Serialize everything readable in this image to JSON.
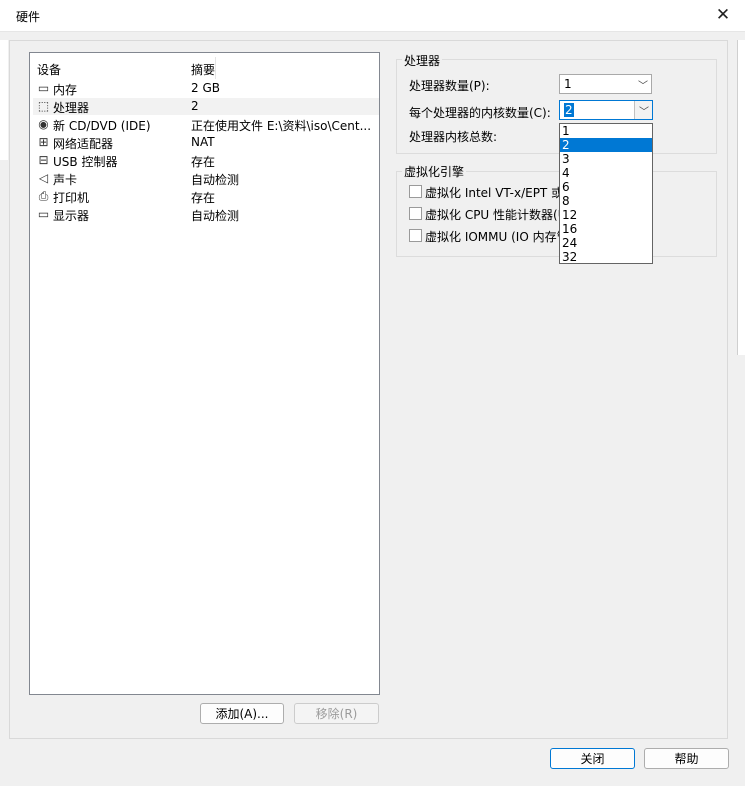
{
  "window": {
    "title": "硬件",
    "close_glyph": "✕"
  },
  "devices": {
    "col_device": "设备",
    "col_summary": "摘要",
    "items": [
      {
        "icon": "memory-icon",
        "glyph": "▭",
        "name": "内存",
        "summary": "2 GB",
        "selected": false
      },
      {
        "icon": "cpu-icon",
        "glyph": "⬚",
        "name": "处理器",
        "summary": "2",
        "selected": true
      },
      {
        "icon": "cd-icon",
        "glyph": "◉",
        "name": "新 CD/DVD (IDE)",
        "summary": "正在使用文件 E:\\资料\\iso\\Cent...",
        "selected": false
      },
      {
        "icon": "network-icon",
        "glyph": "⊞",
        "name": "网络适配器",
        "summary": "NAT",
        "selected": false
      },
      {
        "icon": "usb-icon",
        "glyph": "⊟",
        "name": "USB 控制器",
        "summary": "存在",
        "selected": false
      },
      {
        "icon": "sound-icon",
        "glyph": "◁",
        "name": "声卡",
        "summary": "自动检测",
        "selected": false
      },
      {
        "icon": "printer-icon",
        "glyph": "⎙",
        "name": "打印机",
        "summary": "存在",
        "selected": false
      },
      {
        "icon": "display-icon",
        "glyph": "▭",
        "name": "显示器",
        "summary": "自动检测",
        "selected": false
      }
    ]
  },
  "buttons": {
    "add": "添加(A)...",
    "remove": "移除(R)",
    "close": "关闭",
    "help": "帮助"
  },
  "processor": {
    "group_label": "处理器",
    "count_label": "处理器数量(P):",
    "count_value": "1",
    "cores_label": "每个处理器的内核数量(C):",
    "cores_value": "2",
    "total_label": "处理器内核总数:",
    "core_options": [
      "1",
      "2",
      "3",
      "4",
      "6",
      "8",
      "12",
      "16",
      "24",
      "32"
    ],
    "selected_option": "2"
  },
  "virtualization": {
    "group_label": "虚拟化引擎",
    "options": [
      {
        "label": "虚拟化 Intel VT-x/EPT 或",
        "checked": false
      },
      {
        "label": "虚拟化 CPU 性能计数器(U",
        "checked": false
      },
      {
        "label": "虚拟化 IOMMU (IO 内存管",
        "checked": false
      }
    ]
  },
  "colors": {
    "accent": "#0078d4",
    "list_border": "#828790"
  }
}
